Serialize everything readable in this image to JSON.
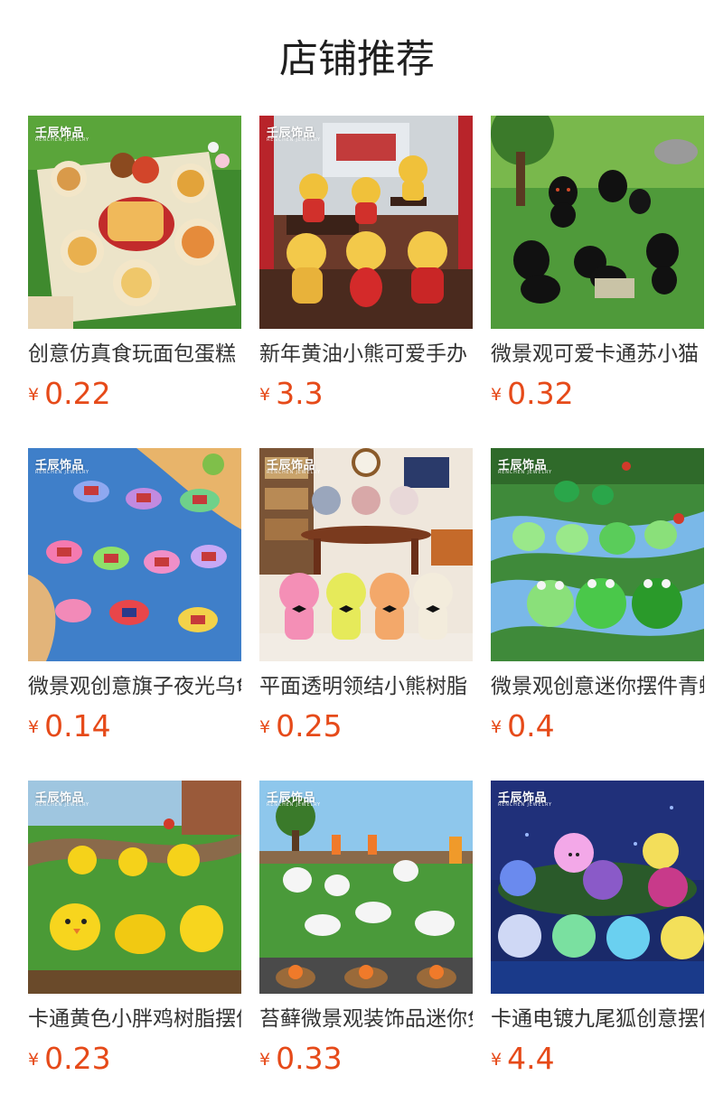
{
  "page": {
    "title": "店铺推荐"
  },
  "products": [
    {
      "name": "创意仿真食玩面包蛋糕",
      "currency": "¥",
      "price": "0.22",
      "brand": "壬辰饰品",
      "brand_sub": "RENCHEN JEWELRY",
      "image_icon": "food-figurines-image"
    },
    {
      "name": "新年黄油小熊可爱手办",
      "currency": "¥",
      "price": "3.3",
      "brand": "壬辰饰品",
      "brand_sub": "RENCHEN JEWELRY",
      "image_icon": "bear-figurines-image"
    },
    {
      "name": "微景观可爱卡通苏小猫",
      "currency": "¥",
      "price": "0.32",
      "brand": "",
      "brand_sub": "",
      "image_icon": "black-cat-figurines-image"
    },
    {
      "name": "微景观创意旗子夜光乌龟",
      "currency": "¥",
      "price": "0.14",
      "brand": "壬辰饰品",
      "brand_sub": "RENCHEN JEWELRY",
      "image_icon": "flag-turtle-figurines-image"
    },
    {
      "name": "平面透明领结小熊树脂",
      "currency": "¥",
      "price": "0.25",
      "brand": "壬辰饰品",
      "brand_sub": "RENCHEN JEWELRY",
      "image_icon": "bowtie-bear-figurines-image"
    },
    {
      "name": "微景观创意迷你摆件青蛙",
      "currency": "¥",
      "price": "0.4",
      "brand": "壬辰饰品",
      "brand_sub": "RENCHEN JEWELRY",
      "image_icon": "frog-figurines-image"
    },
    {
      "name": "卡通黄色小胖鸡树脂摆件",
      "currency": "¥",
      "price": "0.23",
      "brand": "壬辰饰品",
      "brand_sub": "RENCHEN JEWELRY",
      "image_icon": "chick-figurines-image"
    },
    {
      "name": "苔藓微景观装饰品迷你兔",
      "currency": "¥",
      "price": "0.33",
      "brand": "壬辰饰品",
      "brand_sub": "RENCHEN JEWELRY",
      "image_icon": "rabbit-figurines-image"
    },
    {
      "name": "卡通电镀九尾狐创意摆件",
      "currency": "¥",
      "price": "4.4",
      "brand": "壬辰饰品",
      "brand_sub": "RENCHEN JEWELRY",
      "image_icon": "fox-figurines-image"
    }
  ],
  "colors": {
    "price": "#e64a19",
    "title": "#1e1e1e",
    "text": "#333333"
  }
}
